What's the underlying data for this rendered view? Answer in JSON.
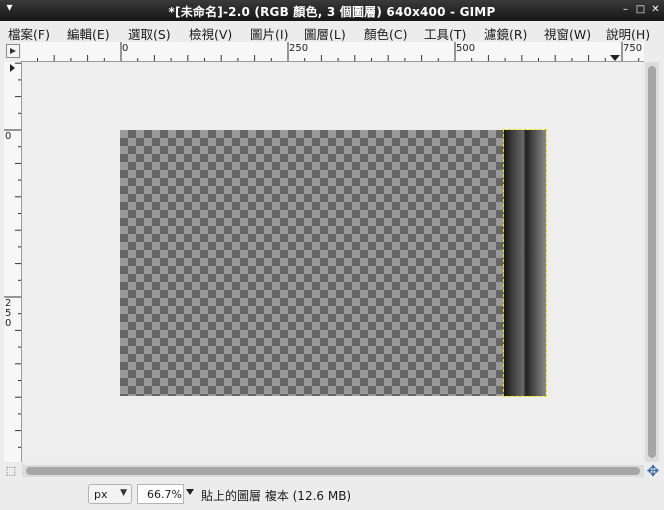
{
  "window": {
    "title": "*[未命名]-2.0 (RGB 顏色, 3 個圖層) 640x400 - GIMP",
    "menu_glyph": "▾",
    "minimize_glyph": "–",
    "maximize_glyph": "□",
    "close_glyph": "✕"
  },
  "menubar": {
    "items": [
      "檔案(F)",
      "編輯(E)",
      "選取(S)",
      "檢視(V)",
      "圖片(I)",
      "圖層(L)",
      "顏色(C)",
      "工具(T)",
      "濾鏡(R)",
      "視窗(W)",
      "說明(H)"
    ]
  },
  "rulers": {
    "horizontal_labels": [
      "0",
      "250",
      "500",
      "750"
    ],
    "vertical_labels": [
      "0",
      "2\n5\n0"
    ]
  },
  "image": {
    "width": 640,
    "height": 400,
    "layers": 3
  },
  "status": {
    "unit": "px",
    "zoom": "66.7%",
    "message": "貼上的圖層 複本 (12.6 MB)"
  },
  "icons": {
    "quickmask": "quick-mask-icon",
    "navigate": "navigate-icon"
  }
}
